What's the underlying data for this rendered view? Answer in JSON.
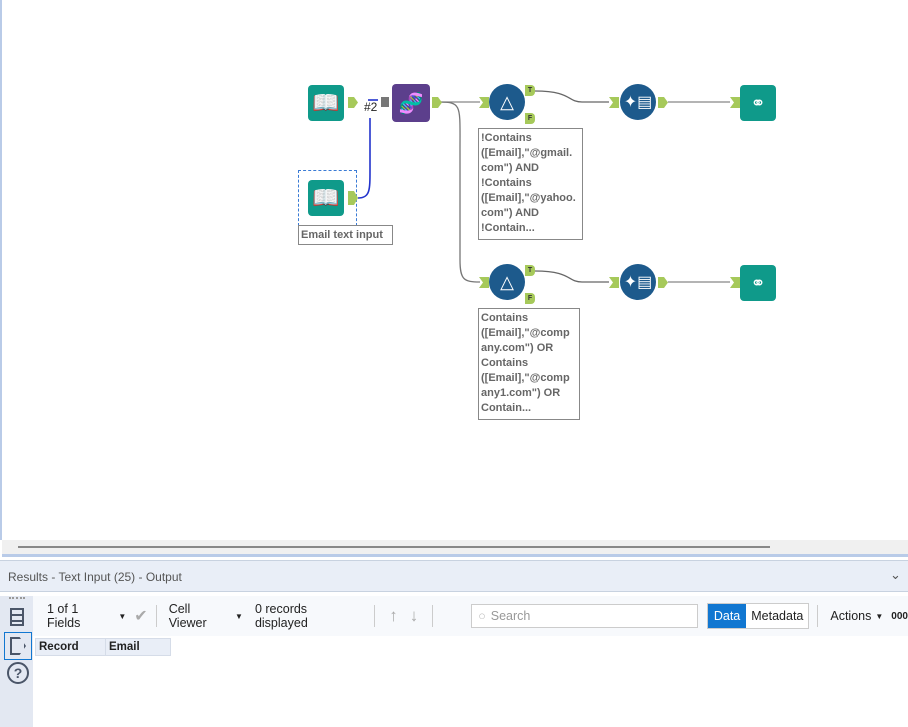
{
  "canvas": {
    "tool_label_count": "#2",
    "text_input_label": "Email text input",
    "filter1_annotation": "!Contains\n([Email],\"@gmail.\ncom\") AND\n!Contains\n([Email],\"@yahoo.\ncom\") AND\n!Contain...",
    "filter2_annotation": "Contains\n([Email],\"@comp\nany.com\") OR\nContains\n([Email],\"@comp\nany1.com\") OR\nContain...",
    "true_anchor": "T",
    "false_anchor": "F"
  },
  "results": {
    "title": "Results - Text Input (25) - Output",
    "fields": "1 of 1 Fields",
    "cell_viewer": "Cell Viewer",
    "records": "0 records displayed",
    "search_placeholder": "Search",
    "data_tab": "Data",
    "metadata_tab": "Metadata",
    "actions": "Actions",
    "overflow": "000",
    "columns": [
      "Record",
      "Email"
    ]
  },
  "colors": {
    "teal": "#0f9a8a",
    "purple": "#5c3f8c",
    "blue": "#1d5a8c",
    "accent": "#1177d1"
  }
}
